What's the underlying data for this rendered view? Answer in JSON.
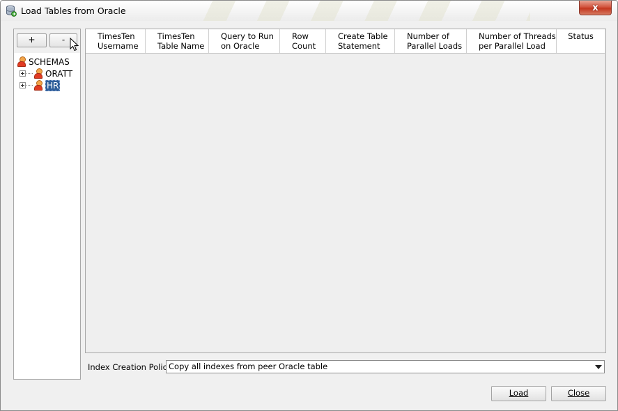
{
  "window": {
    "title": "Load Tables from Oracle",
    "close_glyph": "x",
    "icon": "database-load-icon"
  },
  "left_panel": {
    "add_label": "+",
    "remove_label": "-",
    "tree": {
      "root": "SCHEMAS",
      "children": [
        "ORATT",
        "HR"
      ],
      "selected": "HR"
    }
  },
  "table": {
    "columns": [
      [
        "TimesTen",
        "Username"
      ],
      [
        "TimesTen",
        "Table Name"
      ],
      [
        "Query to Run",
        "on Oracle"
      ],
      [
        "Row",
        "Count"
      ],
      [
        "Create Table",
        "Statement"
      ],
      [
        "Number of",
        "Parallel Loads"
      ],
      [
        "Number of Threads",
        "per Parallel Load"
      ],
      [
        "Status",
        ""
      ]
    ],
    "rows": []
  },
  "index_policy": {
    "label": "Index Creation Policy:",
    "value": "Copy all indexes from peer Oracle table"
  },
  "footer": {
    "load_label": "Load",
    "close_label": "Close"
  }
}
